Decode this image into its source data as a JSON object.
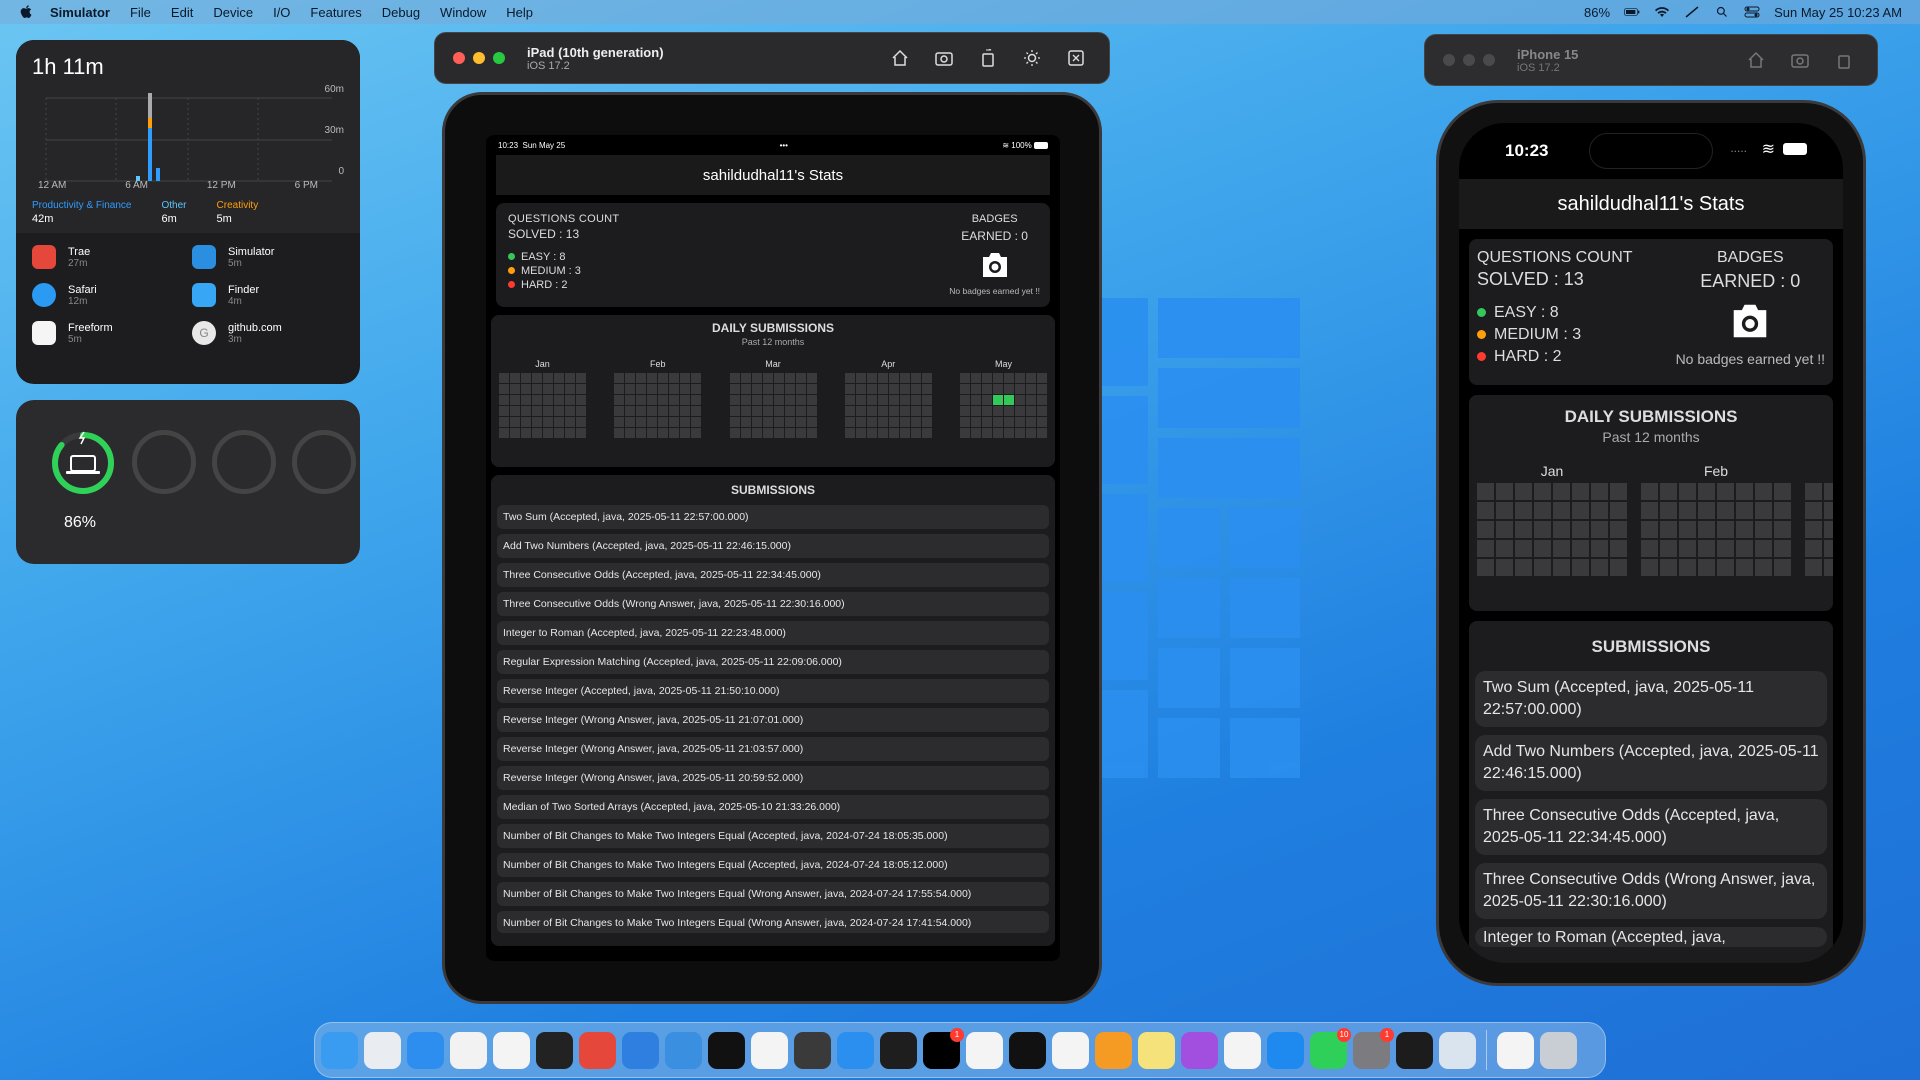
{
  "menubar": {
    "app_name": "Simulator",
    "items": [
      "File",
      "Edit",
      "Device",
      "I/O",
      "Features",
      "Debug",
      "Window",
      "Help"
    ],
    "battery": "86%",
    "datetime": "Sun May 25  10:23 AM"
  },
  "screen_time_widget": {
    "total": "1h 11m",
    "y_labels": [
      "60m",
      "30m",
      "0"
    ],
    "x_labels": [
      "12 AM",
      "6 AM",
      "12 PM",
      "6 PM"
    ],
    "categories": [
      {
        "label": "Productivity & Finance",
        "value": "42m",
        "color": "#2f9cff"
      },
      {
        "label": "Other",
        "value": "6m",
        "color": "#5ac8fa"
      },
      {
        "label": "Creativity",
        "value": "5m",
        "color": "#ff9f0a"
      }
    ],
    "apps": [
      {
        "name": "Trae",
        "time": "27m",
        "icon": "trae-icon",
        "color": "#e5483b"
      },
      {
        "name": "Simulator",
        "time": "5m",
        "icon": "simulator-icon",
        "color": "#2a8fe0"
      },
      {
        "name": "Safari",
        "time": "12m",
        "icon": "safari-icon",
        "color": "#2b9af3"
      },
      {
        "name": "Finder",
        "time": "4m",
        "icon": "finder-icon",
        "color": "#37a6f5"
      },
      {
        "name": "Freeform",
        "time": "5m",
        "icon": "freeform-icon",
        "color": "#f5f5f5"
      },
      {
        "name": "github.com",
        "time": "3m",
        "icon": "github-letter-icon",
        "color": "#e8e8e8",
        "letter": "G"
      }
    ]
  },
  "battery_widget": {
    "percent": "86%",
    "level": 0.86
  },
  "simulators": {
    "ipad": {
      "title": "iPad (10th generation)",
      "os": "iOS 17.2"
    },
    "iphone": {
      "title": "iPhone 15",
      "os": "iOS 17.2"
    }
  },
  "ipad_status": {
    "time": "10:23",
    "date": "Sun May 25",
    "dots": "•••",
    "battery": "100%"
  },
  "iphone_status": {
    "time": "10:23",
    "dots": "....."
  },
  "app": {
    "title": "sahildudhal11's Stats",
    "questions_count_label": "QUESTIONS COUNT",
    "solved": "SOLVED : 13",
    "easy": "EASY : 8",
    "medium": "MEDIUM : 3",
    "hard": "HARD : 2",
    "badges_label": "BADGES",
    "earned": "EARNED : 0",
    "no_badges": "No badges earned yet !!",
    "daily_title": "DAILY SUBMISSIONS",
    "daily_subtitle": "Past 12 months",
    "months_ipad": [
      "Jan",
      "Feb",
      "Mar",
      "Apr",
      "May"
    ],
    "months_iphone": [
      "Jan",
      "Feb"
    ],
    "submissions_title": "SUBMISSIONS",
    "submissions": [
      "Two Sum (Accepted, java, 2025-05-11 22:57:00.000)",
      "Add Two Numbers (Accepted, java, 2025-05-11 22:46:15.000)",
      "Three Consecutive Odds (Accepted, java, 2025-05-11 22:34:45.000)",
      "Three Consecutive Odds (Wrong Answer, java, 2025-05-11 22:30:16.000)",
      "Integer to Roman (Accepted, java, 2025-05-11 22:23:48.000)",
      "Regular Expression Matching (Accepted, java, 2025-05-11 22:09:06.000)",
      "Reverse Integer (Accepted, java, 2025-05-11 21:50:10.000)",
      "Reverse Integer (Wrong Answer, java, 2025-05-11 21:07:01.000)",
      "Reverse Integer (Wrong Answer, java, 2025-05-11 21:03:57.000)",
      "Reverse Integer (Wrong Answer, java, 2025-05-11 20:59:52.000)",
      "Median of Two Sorted Arrays (Accepted, java, 2025-05-10 21:33:26.000)",
      "Number of Bit Changes to Make Two Integers Equal (Accepted, java, 2024-07-24 18:05:35.000)",
      "Number of Bit Changes to Make Two Integers Equal (Accepted, java, 2024-07-24 18:05:12.000)",
      "Number of Bit Changes to Make Two Integers Equal (Wrong Answer, java, 2024-07-24 17:55:54.000)",
      "Number of Bit Changes to Make Two Integers Equal (Wrong Answer, java, 2024-07-24 17:41:54.000)"
    ],
    "iphone_partial_row": "Integer to Roman (Accepted, java,"
  },
  "dock": [
    {
      "name": "finder-icon",
      "color": "#3a9cf0"
    },
    {
      "name": "launchpad-icon",
      "color": "#e9edf2"
    },
    {
      "name": "safari-icon",
      "color": "#2d8ef0"
    },
    {
      "name": "chrome-icon",
      "color": "#f2f2f2"
    },
    {
      "name": "textedit-icon",
      "color": "#f4f4f4"
    },
    {
      "name": "terminal-icon",
      "color": "#222222"
    },
    {
      "name": "trae-icon",
      "color": "#e5483b"
    },
    {
      "name": "xcode-icon",
      "color": "#2f7fe0"
    },
    {
      "name": "simulator-icon",
      "color": "#3a8fe0"
    },
    {
      "name": "intellij-icon",
      "color": "#111111"
    },
    {
      "name": "app-store-icon",
      "color": "#f4f4f4"
    },
    {
      "name": "sublime-icon",
      "color": "#3a3a3a"
    },
    {
      "name": "bluesky-icon",
      "color": "#2b8ff0"
    },
    {
      "name": "figma-icon",
      "color": "#1e1e1e"
    },
    {
      "name": "x-icon",
      "color": "#000000",
      "badge": "1"
    },
    {
      "name": "signal-icon",
      "color": "#f4f4f4"
    },
    {
      "name": "github-icon",
      "color": "#111111"
    },
    {
      "name": "reminders-icon",
      "color": "#f4f4f4"
    },
    {
      "name": "pages-icon",
      "color": "#f59a23"
    },
    {
      "name": "notes-icon",
      "color": "#f5e27a"
    },
    {
      "name": "podcasts-icon",
      "color": "#a24fe0"
    },
    {
      "name": "freeform-icon",
      "color": "#f4f4f4"
    },
    {
      "name": "app-store-blue-icon",
      "color": "#1e8af0"
    },
    {
      "name": "whatsapp-icon",
      "color": "#2fd05a",
      "badge": "10"
    },
    {
      "name": "system-settings-icon",
      "color": "#7b7b80",
      "badge": "1"
    },
    {
      "name": "activity-monitor-icon",
      "color": "#1c1c1c"
    },
    {
      "name": "preview-icon",
      "color": "#d9e4ee"
    },
    {
      "name": "sep",
      "color": ""
    },
    {
      "name": "claude-icon",
      "color": "#f4f4f4"
    },
    {
      "name": "trash-icon",
      "color": "#c9ced4"
    }
  ],
  "heatmap": {
    "ipad_active_may": [
      [
        2,
        3
      ],
      [
        2,
        4
      ]
    ]
  }
}
